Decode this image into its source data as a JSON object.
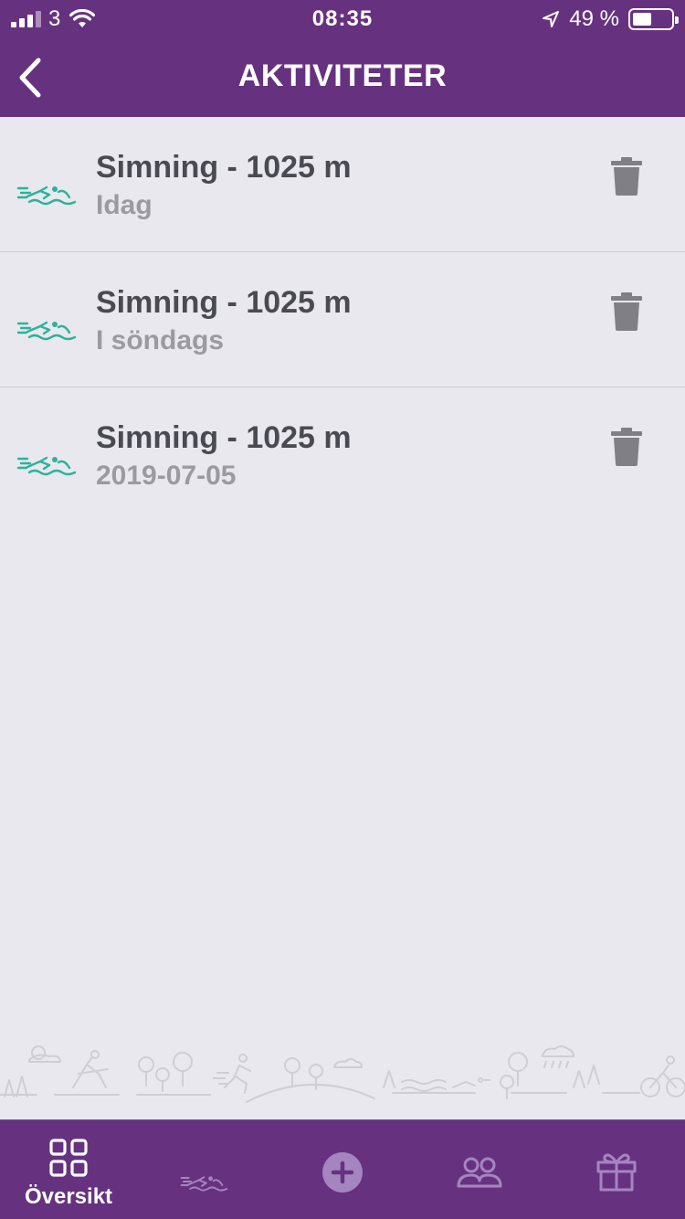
{
  "status_bar": {
    "carrier": "3",
    "time": "08:35",
    "battery_percent": "49 %",
    "battery_level": 0.49
  },
  "header": {
    "title": "AKTIVITETER",
    "back_icon": "chevron-left-icon"
  },
  "activities": [
    {
      "title": "Simning - 1025 m",
      "date": "Idag",
      "icon": "swimming-icon"
    },
    {
      "title": "Simning - 1025 m",
      "date": "I söndags",
      "icon": "swimming-icon"
    },
    {
      "title": "Simning - 1025 m",
      "date": "2019-07-05",
      "icon": "swimming-icon"
    }
  ],
  "tabbar": {
    "tabs": [
      {
        "label": "Översikt",
        "icon": "grid-icon",
        "active": true
      },
      {
        "label": "",
        "icon": "swimming-icon",
        "active": false
      },
      {
        "label": "",
        "icon": "plus-circle-icon",
        "active": false
      },
      {
        "label": "",
        "icon": "friends-icon",
        "active": false
      },
      {
        "label": "",
        "icon": "gift-icon",
        "active": false
      }
    ]
  },
  "colors": {
    "brand_purple": "#663280",
    "background": "#e9e8ee",
    "activity_teal": "#2bb39a",
    "text_dark": "#4a4a52",
    "text_muted": "#9a9aa0",
    "inactive_tab": "#a585c0"
  }
}
